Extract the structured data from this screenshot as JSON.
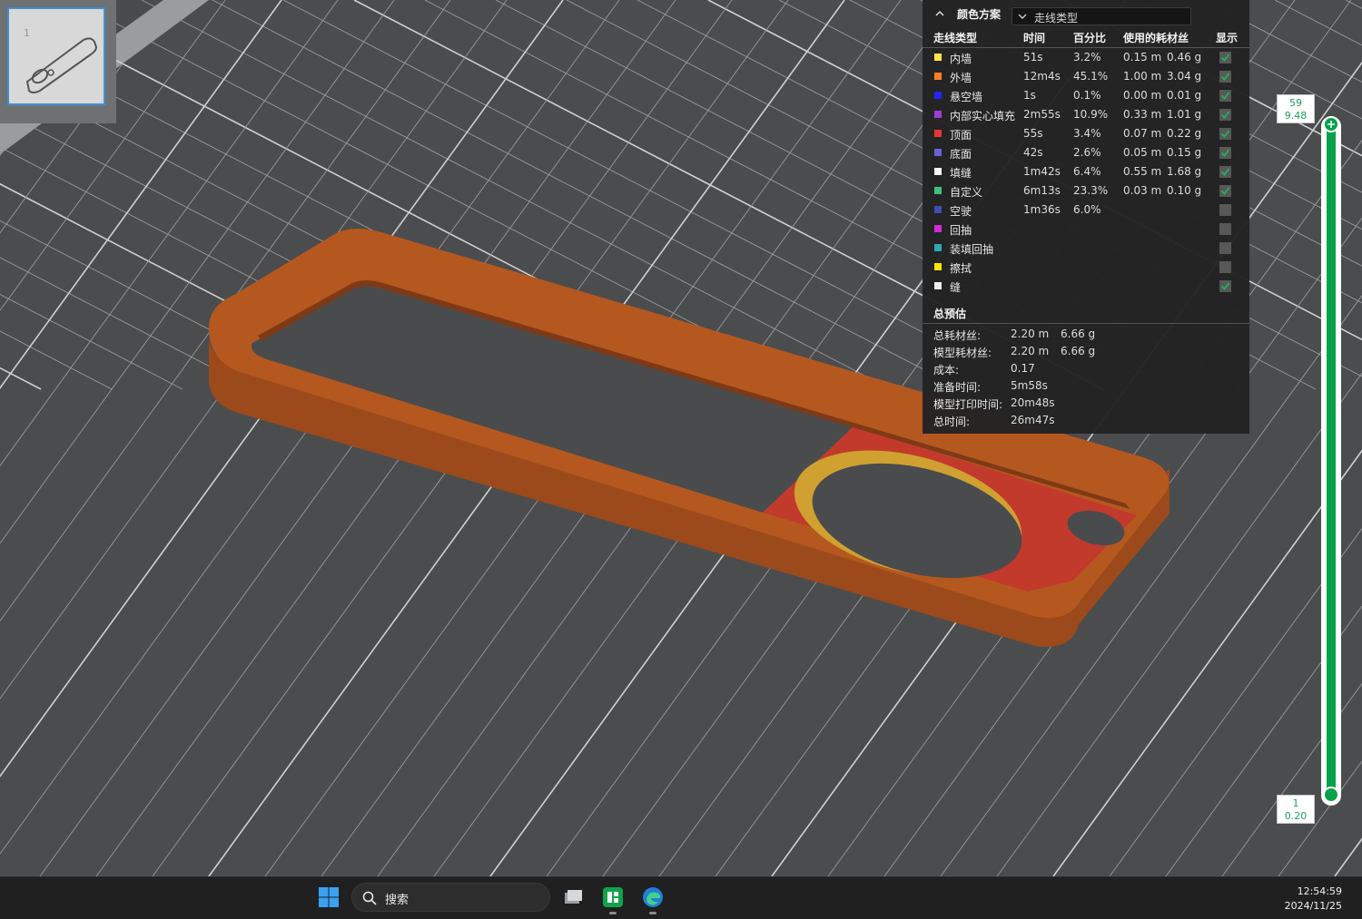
{
  "thumbnail": {
    "plate_number": "1"
  },
  "legend": {
    "scheme_label": "颜色方案",
    "scheme_value": "走线类型",
    "columns": {
      "type": "走线类型",
      "time": "时间",
      "percent": "百分比",
      "filament": "使用的耗材丝",
      "show": "显示"
    },
    "rows": [
      {
        "label": "内墙",
        "color": "#ffe34d",
        "time": "51s",
        "percent": "3.2%",
        "meters": "0.15 m",
        "grams": "0.46 g",
        "shown": true
      },
      {
        "label": "外墙",
        "color": "#ff7f2a",
        "time": "12m4s",
        "percent": "45.1%",
        "meters": "1.00 m",
        "grams": "3.04 g",
        "shown": true
      },
      {
        "label": "悬空墙",
        "color": "#2222ff",
        "time": "1s",
        "percent": "0.1%",
        "meters": "0.00 m",
        "grams": "0.01 g",
        "shown": true
      },
      {
        "label": "内部实心填充",
        "color": "#9a3fd0",
        "time": "2m55s",
        "percent": "10.9%",
        "meters": "0.33 m",
        "grams": "1.01 g",
        "shown": true
      },
      {
        "label": "顶面",
        "color": "#e8353a",
        "time": "55s",
        "percent": "3.4%",
        "meters": "0.07 m",
        "grams": "0.22 g",
        "shown": true
      },
      {
        "label": "底面",
        "color": "#6a60d8",
        "time": "42s",
        "percent": "2.6%",
        "meters": "0.05 m",
        "grams": "0.15 g",
        "shown": true
      },
      {
        "label": "填缝",
        "color": "#ffffff",
        "time": "1m42s",
        "percent": "6.4%",
        "meters": "0.55 m",
        "grams": "1.68 g",
        "shown": true
      },
      {
        "label": "自定义",
        "color": "#3fc07a",
        "time": "6m13s",
        "percent": "23.3%",
        "meters": "0.03 m",
        "grams": "0.10 g",
        "shown": true
      },
      {
        "label": "空驶",
        "color": "#3f4fb0",
        "time": "1m36s",
        "percent": "6.0%",
        "meters": "",
        "grams": "",
        "shown": false
      },
      {
        "label": "回抽",
        "color": "#d22bd2",
        "time": "",
        "percent": "",
        "meters": "",
        "grams": "",
        "shown": false
      },
      {
        "label": "装填回抽",
        "color": "#2fa6b8",
        "time": "",
        "percent": "",
        "meters": "",
        "grams": "",
        "shown": false
      },
      {
        "label": "擦拭",
        "color": "#ffe600",
        "time": "",
        "percent": "",
        "meters": "",
        "grams": "",
        "shown": false
      },
      {
        "label": "缝",
        "color": "#eeeeee",
        "time": "",
        "percent": "",
        "meters": "",
        "grams": "",
        "shown": true
      }
    ],
    "summary_title": "总预估",
    "summary": [
      {
        "label": "总耗材丝:",
        "v1": "2.20 m",
        "v2": "6.66 g"
      },
      {
        "label": "模型耗材丝:",
        "v1": "2.20 m",
        "v2": "6.66 g"
      },
      {
        "label": "成本:",
        "v1": "0.17",
        "v2": ""
      },
      {
        "label": "准备时间:",
        "v1": "5m58s",
        "v2": ""
      },
      {
        "label": "模型打印时间:",
        "v1": "20m48s",
        "v2": ""
      },
      {
        "label": "总时间:",
        "v1": "26m47s",
        "v2": ""
      }
    ]
  },
  "layer_slider": {
    "top_layer": "59",
    "top_height": "9.48",
    "bottom_layer": "1",
    "bottom_height": "0.20",
    "accent": "#0aa14c"
  },
  "model": {
    "wall_color": "#b0551f",
    "top_color": "#c8402b"
  },
  "taskbar": {
    "search_label": "搜索",
    "time": "12:54:59",
    "date": "2024/11/25",
    "apps": [
      "file-explorer-icon",
      "spreadsheet-app-icon",
      "edge-browser-icon"
    ]
  }
}
